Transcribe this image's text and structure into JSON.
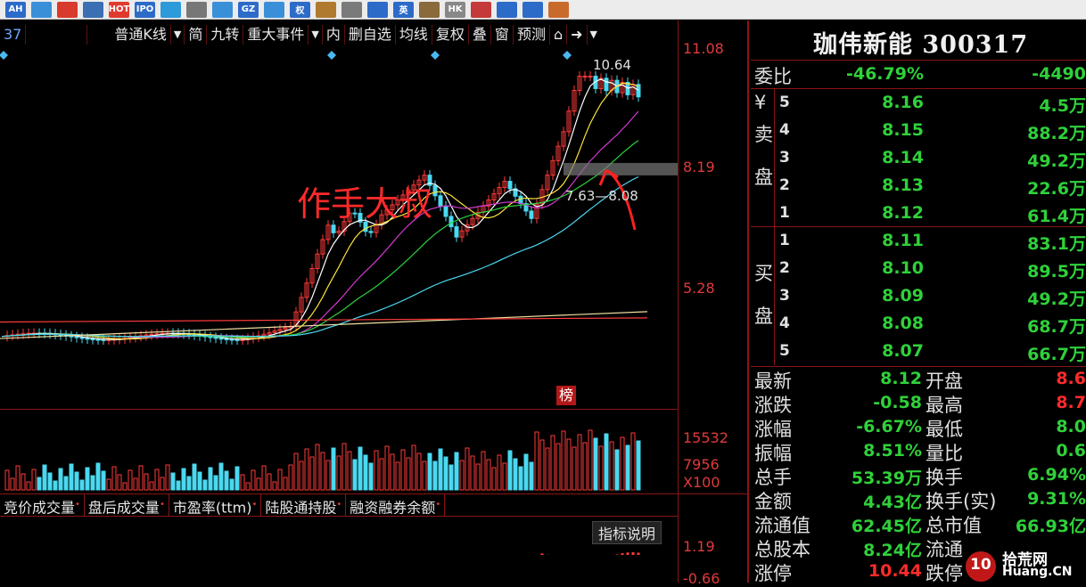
{
  "toolbar": {
    "icons": [
      {
        "name": "ah-icon",
        "text": "AH",
        "bg": "#2d6bc9"
      },
      {
        "name": "chart-icon",
        "text": "",
        "bg": "#3a8fd9"
      },
      {
        "name": "swirl-icon",
        "text": "",
        "bg": "#d93a2e"
      },
      {
        "name": "table-icon",
        "text": "",
        "bg": "#3a6fb3"
      },
      {
        "name": "hot-icon",
        "text": "HOT",
        "bg": "#e03a2e"
      },
      {
        "name": "ipo-icon",
        "text": "IPO",
        "bg": "#2d6bc9"
      },
      {
        "name": "globe-icon",
        "text": "",
        "bg": "#2d9ad9"
      },
      {
        "name": "building-icon",
        "text": "",
        "bg": "#777"
      },
      {
        "name": "trend-icon",
        "text": "",
        "bg": "#3a8fd9"
      },
      {
        "name": "gz-icon",
        "text": "GZ",
        "bg": "#2d6bc9"
      },
      {
        "name": "wave-icon",
        "text": "",
        "bg": "#3a8fd9"
      },
      {
        "name": "quan-icon",
        "text": "权",
        "bg": "#2d6bc9"
      },
      {
        "name": "book-icon",
        "text": "",
        "bg": "#b07a2e"
      },
      {
        "name": "box-icon",
        "text": "",
        "bg": "#7a7a7a"
      },
      {
        "name": "circle-icon",
        "text": "",
        "bg": "#2d6bc9"
      },
      {
        "name": "ying-icon",
        "text": "英",
        "bg": "#2d6bc9"
      },
      {
        "name": "bull-icon",
        "text": "",
        "bg": "#8a6a3a"
      },
      {
        "name": "hk-icon",
        "text": "HK",
        "bg": "#888"
      },
      {
        "name": "usflag-icon",
        "text": "",
        "bg": "#c43a3a"
      },
      {
        "name": "edit-icon",
        "text": "",
        "bg": "#2d6bc9"
      },
      {
        "name": "grid-icon",
        "text": "",
        "bg": "#2d6bc9"
      },
      {
        "name": "home-icon",
        "text": "",
        "bg": "#c96a2d"
      }
    ]
  },
  "chart_menu": {
    "code_fragment": "37",
    "kline_type": "普通K线",
    "jian": "简",
    "jiuzhuan": "九转",
    "events": "重大事件",
    "nei": "内",
    "remove_watch": "删自选",
    "ma": "均线",
    "fuquan": "复权",
    "overlay": "叠",
    "window": "窗",
    "forecast": "预测"
  },
  "annotations": {
    "handwritten": "作手大叔",
    "high_label": "10.64",
    "low_label": "7.63—8.08",
    "bang_badge": "榜"
  },
  "price_axis": {
    "top": "11.08",
    "mid": "8.19",
    "low": "5.28"
  },
  "volume_axis": {
    "top": "15532",
    "mid": "7956",
    "unit": "X100"
  },
  "indicator_axis": {
    "top": "1.19",
    "bottom": "-0.66"
  },
  "indicator_tabs": [
    "竞价成交量",
    "盘后成交量",
    "市盈率(ttm)",
    "陆股通持股",
    "融资融券余额"
  ],
  "indicator_help": "指标说明",
  "quote": {
    "title": "珈伟新能 300317",
    "weibi_label": "委比",
    "weibi_pct": "-46.79%",
    "weicha": "-4490",
    "sell_label": "卖",
    "pan_label": "盘",
    "buy_label": "买",
    "yen": "¥",
    "asks": [
      {
        "lvl": "5",
        "price": "8.16",
        "vol": "4.5万"
      },
      {
        "lvl": "4",
        "price": "8.15",
        "vol": "88.2万"
      },
      {
        "lvl": "3",
        "price": "8.14",
        "vol": "49.2万"
      },
      {
        "lvl": "2",
        "price": "8.13",
        "vol": "22.6万"
      },
      {
        "lvl": "1",
        "price": "8.12",
        "vol": "61.4万"
      }
    ],
    "bids": [
      {
        "lvl": "1",
        "price": "8.11",
        "vol": "83.1万"
      },
      {
        "lvl": "2",
        "price": "8.10",
        "vol": "89.5万"
      },
      {
        "lvl": "3",
        "price": "8.09",
        "vol": "49.2万"
      },
      {
        "lvl": "4",
        "price": "8.08",
        "vol": "68.7万"
      },
      {
        "lvl": "5",
        "price": "8.07",
        "vol": "66.7万"
      }
    ],
    "stats": [
      {
        "l": "最新",
        "v": "8.12",
        "vc": "green",
        "r": "开盘",
        "rv": "8.6",
        "rc": "red"
      },
      {
        "l": "涨跌",
        "v": "-0.58",
        "vc": "green",
        "r": "最高",
        "rv": "8.7",
        "rc": "red"
      },
      {
        "l": "涨幅",
        "v": "-6.67%",
        "vc": "green",
        "r": "最低",
        "rv": "8.0",
        "rc": "green"
      },
      {
        "l": "振幅",
        "v": "8.51%",
        "vc": "green",
        "r": "量比",
        "rv": "0.6",
        "rc": "green"
      },
      {
        "l": "总手",
        "v": "53.39万",
        "vc": "green",
        "r": "换手",
        "rv": "6.94%",
        "rc": "green"
      },
      {
        "l": "金额",
        "v": "4.43亿",
        "vc": "green",
        "r": "换手(实)",
        "rv": "9.31%",
        "rc": "green"
      },
      {
        "l": "流通值",
        "v": "62.45亿",
        "vc": "green",
        "r": "总市值",
        "rv": "66.93亿",
        "rc": "green"
      },
      {
        "l": "总股本",
        "v": "8.24亿",
        "vc": "green",
        "r": "流通",
        "rv": "",
        "rc": "green"
      },
      {
        "l": "涨停",
        "v": "10.44",
        "vc": "red",
        "r": "跌停",
        "rv": "",
        "rc": "green"
      }
    ]
  },
  "watermark": {
    "brand": "拾荒网",
    "url": "Huang.CN",
    "logo": "10"
  }
}
